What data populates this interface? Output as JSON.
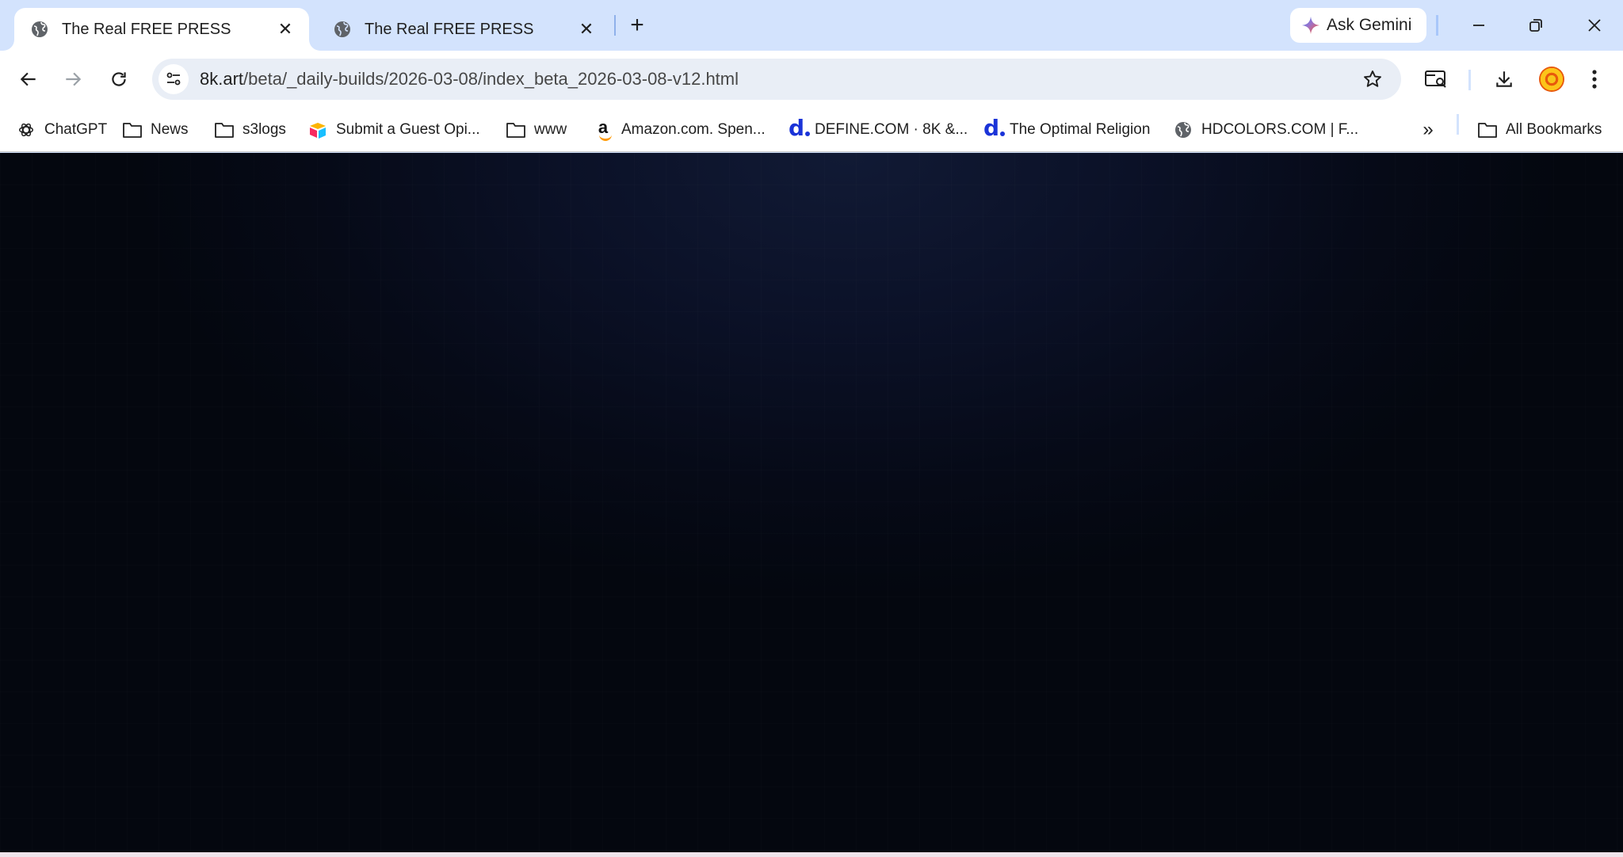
{
  "browser": {
    "tabs": [
      {
        "title": "The Real FREE PRESS",
        "active": true
      },
      {
        "title": "The Real FREE PRESS",
        "active": false
      }
    ],
    "new_tab_label": "+",
    "gemini_label": "Ask Gemini",
    "url_host": "8k.art",
    "url_path": "/beta/_daily-builds/2026-03-08/index_beta_2026-03-08-v12.html"
  },
  "bookmarks": [
    {
      "label": "ChatGPT",
      "icon": "chatgpt-icon"
    },
    {
      "label": "News",
      "icon": "folder-icon"
    },
    {
      "label": "s3logs",
      "icon": "folder-icon"
    },
    {
      "label": "Submit a Guest Opi...",
      "icon": "airtable-icon"
    },
    {
      "label": "www",
      "icon": "folder-icon"
    },
    {
      "label": "Amazon.com. Spen...",
      "icon": "amazon-icon"
    },
    {
      "label": "DEFINE.COM · 8K &...",
      "icon": "define-d-icon"
    },
    {
      "label": "The Optimal Religion",
      "icon": "define-d-icon"
    },
    {
      "label": "HDCOLORS.COM | F...",
      "icon": "globe-icon"
    }
  ],
  "bookmarks_more_label": "»",
  "all_bookmarks_label": "All Bookmarks",
  "colors": {
    "tabstrip": "#d3e3fd",
    "omnibox": "#e9eef6",
    "page_background": "#060a17"
  }
}
